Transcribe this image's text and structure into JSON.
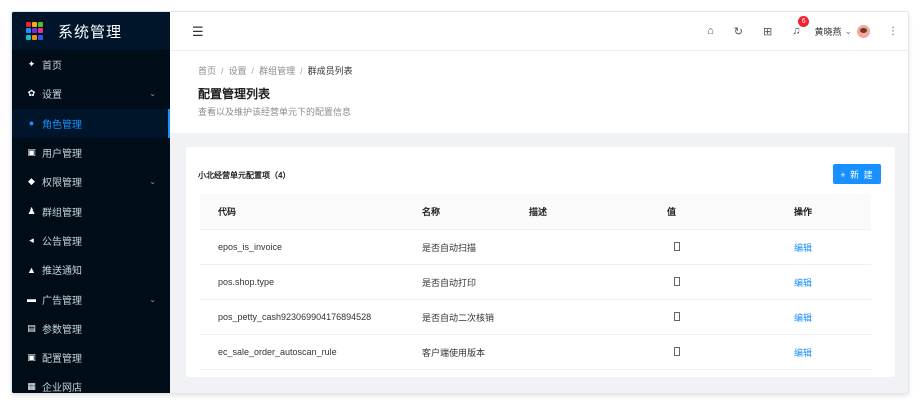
{
  "app": {
    "title": "系统管理",
    "logo_colors": [
      "#f5222d",
      "#faad14",
      "#52c41a",
      "#1890ff",
      "#722ed1",
      "#eb2f96",
      "#13c2c2",
      "#fa8c16",
      "#2f54eb"
    ]
  },
  "sidebar": {
    "items": [
      {
        "label": "首页",
        "icon": "home-icon",
        "glyph": "✦",
        "expandable": false,
        "active": false
      },
      {
        "label": "设置",
        "icon": "settings-icon",
        "glyph": "✿",
        "expandable": true,
        "active": false
      },
      {
        "label": "角色管理",
        "icon": "role-icon",
        "glyph": "●",
        "expandable": false,
        "active": true
      },
      {
        "label": "用户管理",
        "icon": "user-card-icon",
        "glyph": "▣",
        "expandable": false,
        "active": false
      },
      {
        "label": "权限管理",
        "icon": "shield-icon",
        "glyph": "◆",
        "expandable": true,
        "active": false
      },
      {
        "label": "群组管理",
        "icon": "group-icon",
        "glyph": "♟",
        "expandable": false,
        "active": false
      },
      {
        "label": "公告管理",
        "icon": "megaphone-icon",
        "glyph": "◂",
        "expandable": false,
        "active": false
      },
      {
        "label": "推送通知",
        "icon": "bell-icon",
        "glyph": "▲",
        "expandable": false,
        "active": false
      },
      {
        "label": "广告管理",
        "icon": "ad-icon",
        "glyph": "▬",
        "expandable": true,
        "active": false
      },
      {
        "label": "参数管理",
        "icon": "params-icon",
        "glyph": "▤",
        "expandable": false,
        "active": false
      },
      {
        "label": "配置管理",
        "icon": "config-icon",
        "glyph": "▣",
        "expandable": false,
        "active": false
      },
      {
        "label": "企业网店",
        "icon": "store-icon",
        "glyph": "▦",
        "expandable": false,
        "active": false
      }
    ]
  },
  "topbar": {
    "menu_icon": "☰",
    "notification_count": "6",
    "user_name": "黄晓燕",
    "chevron": "⌄",
    "more": "⋮"
  },
  "breadcrumb": {
    "items": [
      "首页",
      "设置",
      "群组管理"
    ],
    "current": "群成员列表",
    "separator": "/"
  },
  "page": {
    "title": "配置管理列表",
    "description": "查看以及维护该经营单元下的配置信息"
  },
  "card": {
    "title": "小北经营单元配置项（4）",
    "new_button": "+ 新 建",
    "columns": [
      "代码",
      "名称",
      "描述",
      "值",
      "操作"
    ],
    "rows": [
      {
        "code": "epos_is_invoice",
        "name": "是否自动扫描",
        "desc": "",
        "action": "编辑"
      },
      {
        "code": "pos.shop.type",
        "name": "是否自动打印",
        "desc": "",
        "action": "编辑"
      },
      {
        "code": "pos_petty_cash923069904176894528",
        "name": "是否自动二次核销",
        "desc": "",
        "action": "编辑"
      },
      {
        "code": "ec_sale_order_autoscan_rule",
        "name": "客户端使用版本",
        "desc": "",
        "action": "编辑"
      }
    ]
  }
}
